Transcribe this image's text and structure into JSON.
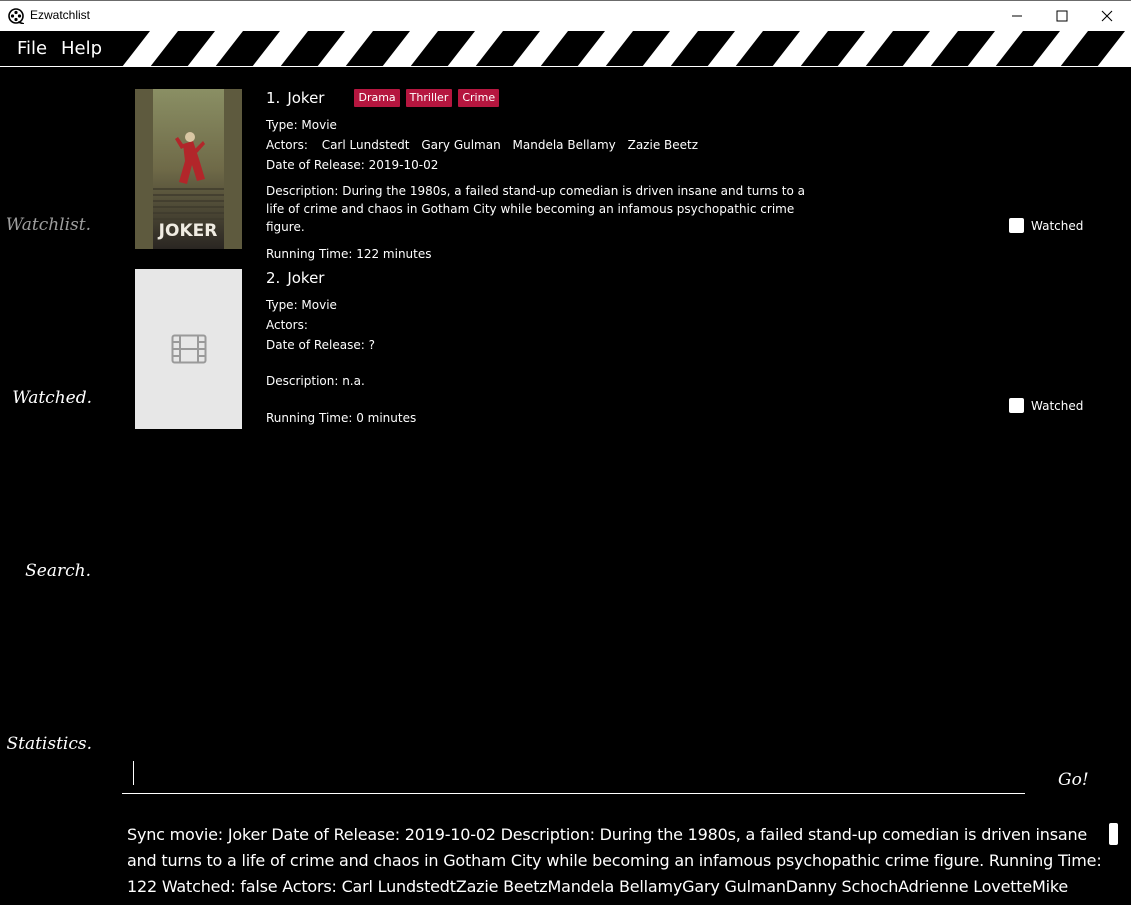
{
  "window": {
    "title": "Ezwatchlist"
  },
  "menu": {
    "file": "File",
    "help": "Help"
  },
  "sidebar": {
    "watchlist": "Watchlist.",
    "watched": "Watched.",
    "search": "Search.",
    "statistics": "Statistics."
  },
  "movies": [
    {
      "index": "1.",
      "title": "Joker",
      "genres": [
        "Drama",
        "Thriller",
        "Crime"
      ],
      "type": "Type: Movie",
      "actors_label": "Actors:",
      "actors": [
        "Carl Lundstedt",
        "Gary Gulman",
        "Mandela Bellamy",
        "Zazie Beetz"
      ],
      "release": "Date of Release: 2019-10-02",
      "description": "Description: During the 1980s, a failed stand-up comedian is driven insane and turns to a life of crime and chaos in Gotham City while becoming an infamous psychopathic crime figure.",
      "runtime": "Running Time: 122 minutes",
      "watched_label": "Watched",
      "poster_text": "JOKER"
    },
    {
      "index": "2.",
      "title": "Joker",
      "type": "Type: Movie",
      "actors_label": "Actors:",
      "release": "Date of Release: ?",
      "description": "Description: n.a.",
      "runtime": "Running Time: 0 minutes",
      "watched_label": "Watched"
    }
  ],
  "command": {
    "value": "",
    "go_label": "Go!"
  },
  "result": {
    "text": "Sync movie: Joker Date of Release: 2019-10-02 Description: During the 1980s, a failed stand-up comedian is driven insane and turns to a life of crime and chaos in Gotham City while becoming an infamous psychopathic crime figure. Running Time: 122 Watched: false Actors: Carl LundstedtZazie BeetzMandela BellamyGary GulmanDanny SchochAdrienne LovetteMike TrollFrances ConroyPeter"
  },
  "colors": {
    "genre_badge": "#b5163f",
    "inactive_nav": "#9e9e9e"
  }
}
